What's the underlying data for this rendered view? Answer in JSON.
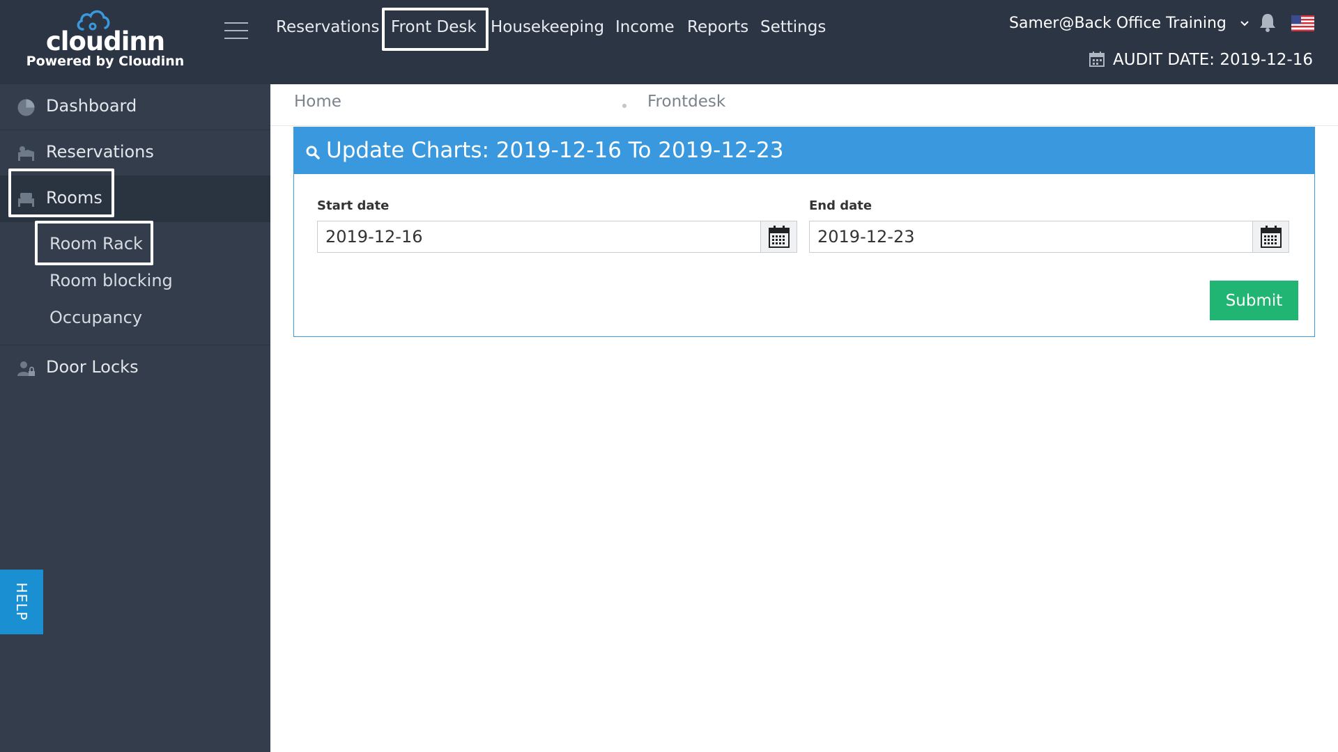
{
  "brand": {
    "name": "cloudinn",
    "tagline": "Powered by Cloudinn",
    "accent": "#3a99de"
  },
  "topnav": {
    "items": [
      {
        "label": "Reservations"
      },
      {
        "label": "Front Desk",
        "highlighted": true
      },
      {
        "label": "Housekeeping"
      },
      {
        "label": "Income"
      },
      {
        "label": "Reports"
      },
      {
        "label": "Settings"
      }
    ]
  },
  "user": {
    "name": "Samer@Back Office Training",
    "chevron_icon": "chevron-down-icon",
    "bell_icon": "bell-icon",
    "flag_icon": "us-flag-icon"
  },
  "audit": {
    "label": "AUDIT DATE: 2019-12-16",
    "icon": "calendar-icon"
  },
  "sidebar": {
    "items": [
      {
        "label": "Dashboard",
        "icon": "pie-chart-icon"
      },
      {
        "label": "Reservations",
        "icon": "bed-guest-icon"
      },
      {
        "label": "Rooms",
        "icon": "bed-icon",
        "active": true
      },
      {
        "label": "Door Locks",
        "icon": "user-lock-icon"
      }
    ],
    "rooms_sub": [
      {
        "label": "Room Rack",
        "highlighted": true
      },
      {
        "label": "Room blocking"
      },
      {
        "label": "Occupancy"
      }
    ],
    "help": "HELP"
  },
  "breadcrumb": {
    "home": "Home",
    "current": "Frontdesk"
  },
  "panel": {
    "title": "Update Charts: 2019-12-16 To 2019-12-23",
    "icon": "search-icon",
    "start_label": "Start date",
    "start_value": "2019-12-16",
    "end_label": "End date",
    "end_value": "2019-12-23",
    "submit": "Submit",
    "submit_color": "#21b574"
  }
}
